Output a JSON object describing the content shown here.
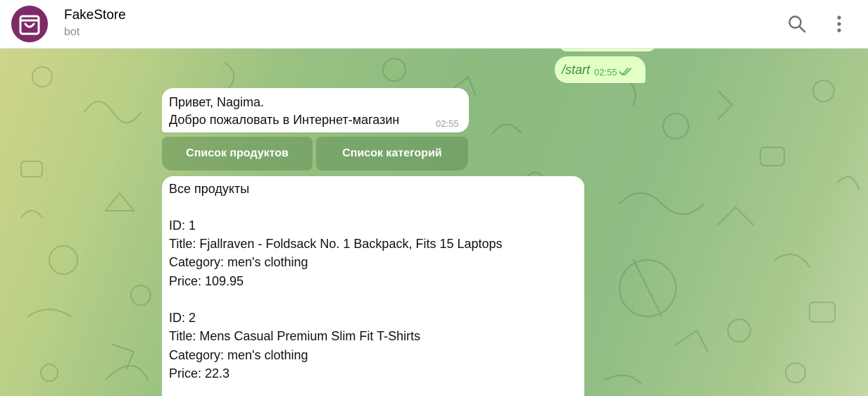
{
  "header": {
    "title": "FakeStore",
    "subtitle": "bot",
    "avatar_color": "#7d2a68",
    "avatar_icon": "shopping-bag-icon",
    "search_icon": "search-icon",
    "menu_icon": "more-vertical-icon"
  },
  "chat": {
    "outgoing": {
      "text": "/start",
      "time": "02:55",
      "status_icon": "double-check-icon",
      "bubble_color": "#e2ffc7"
    },
    "greeting": {
      "line1": "Привет, Nagima.",
      "line2": "Добро пожаловать в Интернет-магазин",
      "time": "02:55"
    },
    "keyboard": {
      "products_label": "Список продуктов",
      "categories_label": "Список категорий"
    },
    "products": {
      "heading": "Все продукты",
      "items": [
        {
          "id": "ID: 1",
          "title": "Title: Fjallraven - Foldsack No. 1 Backpack, Fits 15 Laptops",
          "category": "Category: men's clothing",
          "price": "Price: 109.95"
        },
        {
          "id": "ID: 2",
          "title": "Title: Mens Casual Premium Slim Fit T-Shirts",
          "category": "Category: men's clothing",
          "price": "Price: 22.3"
        }
      ]
    }
  }
}
